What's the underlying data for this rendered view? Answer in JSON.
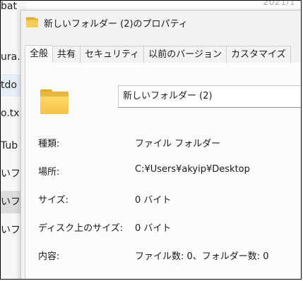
{
  "background": {
    "top_right_text": "2021/1",
    "items": [
      {
        "label": "bat"
      },
      {
        "label": "ura."
      },
      {
        "label": "tdo"
      },
      {
        "label": "o.tx"
      },
      {
        "label": "Tub"
      },
      {
        "label": "いフ"
      },
      {
        "label": "いフ"
      },
      {
        "label": "いフ"
      }
    ]
  },
  "dialog": {
    "title": "新しいフォルダー (2)のプロパティ",
    "tabs": [
      {
        "label": "全般"
      },
      {
        "label": "共有"
      },
      {
        "label": "セキュリティ"
      },
      {
        "label": "以前のバージョン"
      },
      {
        "label": "カスタマイズ"
      }
    ],
    "folder_name": "新しいフォルダー (2)",
    "properties": [
      {
        "label": "種類:",
        "value": "ファイル フォルダー"
      },
      {
        "label": "場所:",
        "value": "C:¥Users¥akyip¥Desktop"
      },
      {
        "label": "サイズ:",
        "value": "0 バイト"
      },
      {
        "label": "ディスク上のサイズ:",
        "value": "0 バイト"
      },
      {
        "label": "内容:",
        "value": "ファイル数: 0、フォルダー数: 0"
      }
    ]
  },
  "colors": {
    "folder_yellow": "#f6cd58",
    "folder_dark": "#e8b73f",
    "selected_row": "#dcdcdc"
  }
}
